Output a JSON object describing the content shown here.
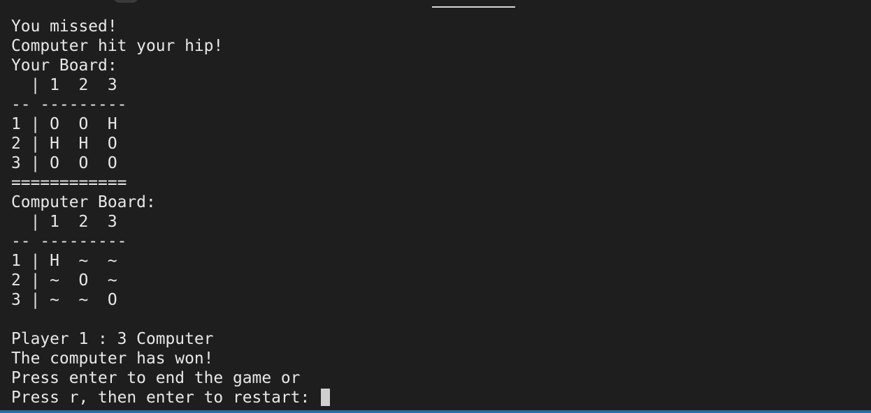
{
  "colors": {
    "background": "#1e1e1e",
    "text": "#e8e8e8",
    "cursor": "#d0d0d0",
    "status_bar": "#1e6fb4"
  },
  "terminal": {
    "lines": [
      "You missed!",
      "Computer hit your hip!",
      "Your Board:",
      "  | 1  2  3",
      "-- ---------",
      "1 | O  O  H",
      "2 | H  H  O",
      "3 | O  O  O",
      "============",
      "Computer Board:",
      "  | 1  2  3",
      "-- ---------",
      "1 | H  ~  ~",
      "2 | ~  O  ~",
      "3 | ~  ~  O",
      "",
      "Player 1 : 3 Computer",
      "The computer has won!",
      "Press enter to end the game or"
    ],
    "prompt": "Press r, then enter to restart: "
  }
}
